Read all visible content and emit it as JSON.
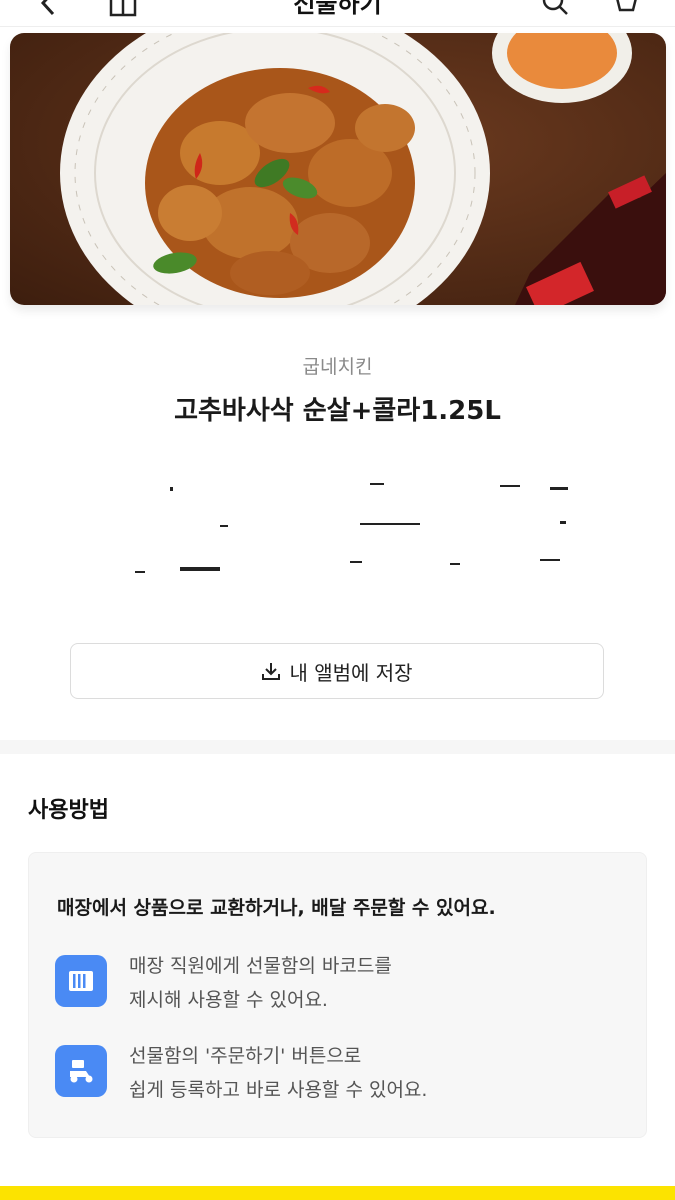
{
  "header": {
    "title": "선물하기"
  },
  "product": {
    "brand": "굽네치킨",
    "name": "고추바사삭 순살+콜라1.25L"
  },
  "save_button": {
    "label": "내 앨범에 저장"
  },
  "howto": {
    "title": "사용방법",
    "headline": "매장에서 상품으로 교환하거나, 배달 주문할 수 있어요.",
    "steps": [
      {
        "line1": "매장 직원에게 선물함의 바코드를",
        "line2": "제시해 사용할 수 있어요."
      },
      {
        "line1": "선물함의 '주문하기' 버튼으로",
        "line2": "쉽게 등록하고 바로 사용할 수 있어요."
      }
    ]
  },
  "colors": {
    "accent": "#fce300",
    "step_icon": "#4a8af4"
  }
}
